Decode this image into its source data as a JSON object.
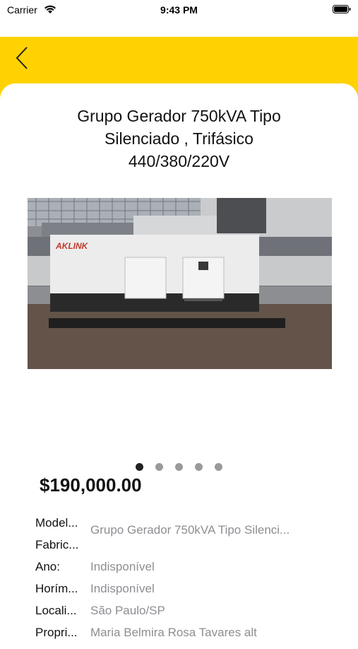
{
  "status_bar": {
    "carrier": "Carrier",
    "time": "9:43 PM",
    "icons": [
      "wifi-icon",
      "battery-icon"
    ]
  },
  "nav": {
    "accent_color": "#FFD200",
    "back_icon": "chevron-left-icon"
  },
  "product": {
    "title_lines": [
      "Grupo Gerador 750kVA Tipo",
      "Silenciado , Trifásico",
      "440/380/220V"
    ],
    "image_brand_text": "AKLINK",
    "carousel": {
      "total": 5,
      "current": 1
    },
    "price": "$190,000.00",
    "specs": [
      {
        "label": "Model...",
        "value": ""
      },
      {
        "label": "Fabric...",
        "value": ""
      },
      {
        "label": "Ano:",
        "value": "Indisponível"
      },
      {
        "label": "Horím...",
        "value": "Indisponível"
      },
      {
        "label": "Locali...",
        "value": "São Paulo/SP"
      },
      {
        "label": "Propri...",
        "value": "Maria Belmira Rosa Tavares alt"
      }
    ],
    "model_fabricante_value": "Grupo Gerador 750kVA Tipo Silenci..."
  }
}
